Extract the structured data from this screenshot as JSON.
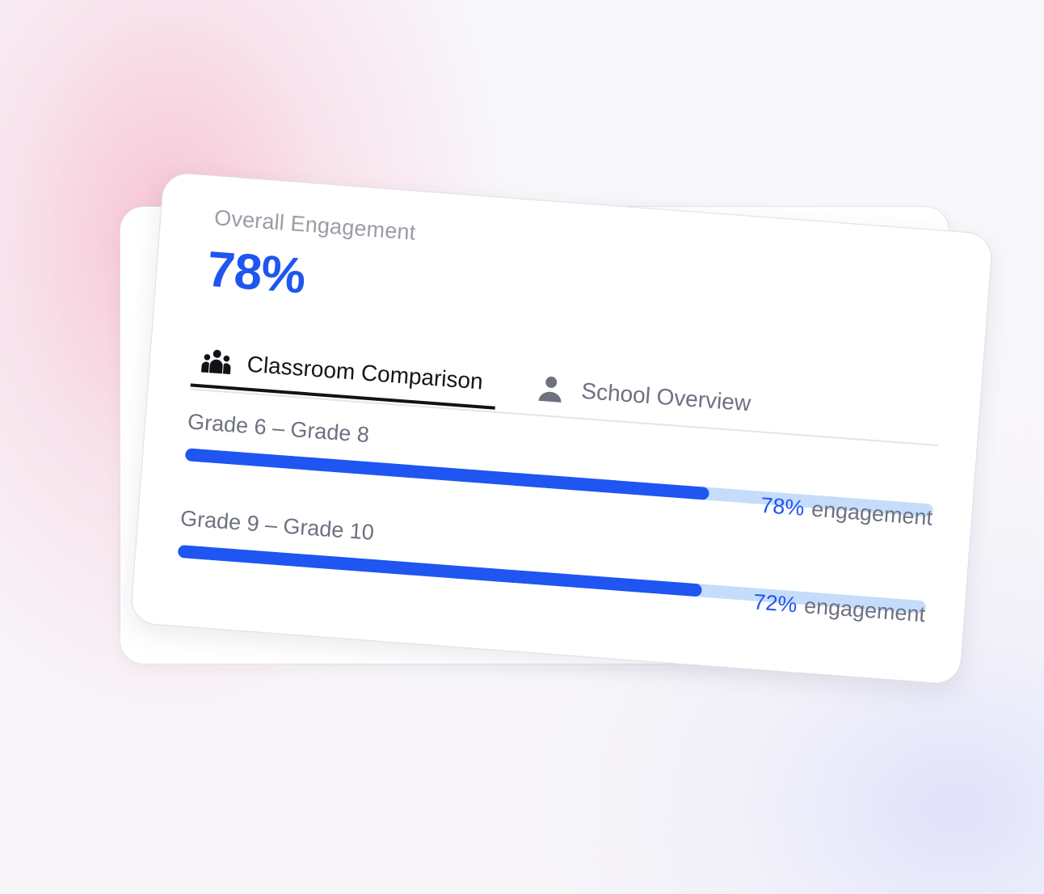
{
  "overall": {
    "label": "Overall Engagement",
    "value": "78%"
  },
  "tabs": [
    {
      "label": "Classroom Comparison",
      "icon": "group-icon",
      "active": true
    },
    {
      "label": "School Overview",
      "icon": "person-icon",
      "active": false
    }
  ],
  "grades": [
    {
      "label": "Grade 6 – Grade 8",
      "percent_text": "78%",
      "suffix": "engagement",
      "value": 0.7
    },
    {
      "label": "Grade 9 – Grade 10",
      "percent_text": "72%",
      "suffix": "engagement",
      "value": 0.7
    }
  ],
  "colors": {
    "accent": "#1f55f0",
    "track": "#c5dcfb",
    "muted_text": "#6d7180"
  }
}
